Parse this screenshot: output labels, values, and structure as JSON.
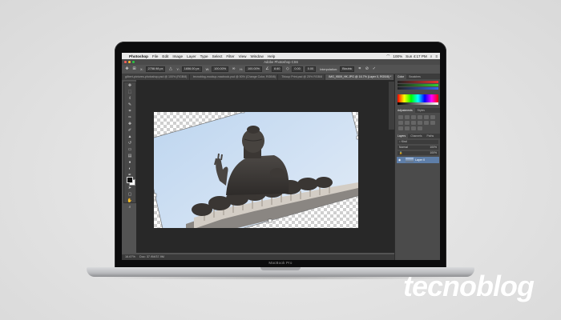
{
  "macos_menubar": {
    "app_name": "Photoshop",
    "menus": [
      "File",
      "Edit",
      "Image",
      "Layer",
      "Type",
      "Select",
      "Filter",
      "View",
      "Window",
      "Help"
    ],
    "status": {
      "battery": "100%",
      "clock": "Sun 4:17 PM"
    }
  },
  "window": {
    "title": "Adobe Photoshop CS6"
  },
  "options_bar": {
    "x": "2758.98 px",
    "y": "1656.00 px",
    "w": "100.00%",
    "h": "100.00%",
    "angle": "8.60",
    "interpolation_label": "Interpolation:",
    "interpolation_value": "Bicubic"
  },
  "document_tabs": [
    "gilbert-pictures-photoshop.psd @ 100% (RGB/8)",
    "tecnoblog-mockup-macbook.psd @ 50% (Change Color, RGB/8)",
    "Tbloup Print.psd @ 25% RGB/8",
    "IMG_9509_HK.JPG @ 16.7% (Layer 0, RGB/8) *"
  ],
  "status_bar": {
    "zoom": "16.67%",
    "doc": "Doc: 37.9M/37.9M"
  },
  "panels": {
    "color_tabs": [
      "Color",
      "Swatches"
    ],
    "adjust_tabs": [
      "Adjustments",
      "Styles"
    ],
    "layer_tabs": [
      "Layers",
      "Channels",
      "Paths"
    ],
    "blend_mode": "Normal",
    "opacity": "100%",
    "fill": "100%",
    "layer_name": "Layer 0"
  },
  "laptop_label": "MacBook Pro",
  "watermark": "tecnoblog"
}
